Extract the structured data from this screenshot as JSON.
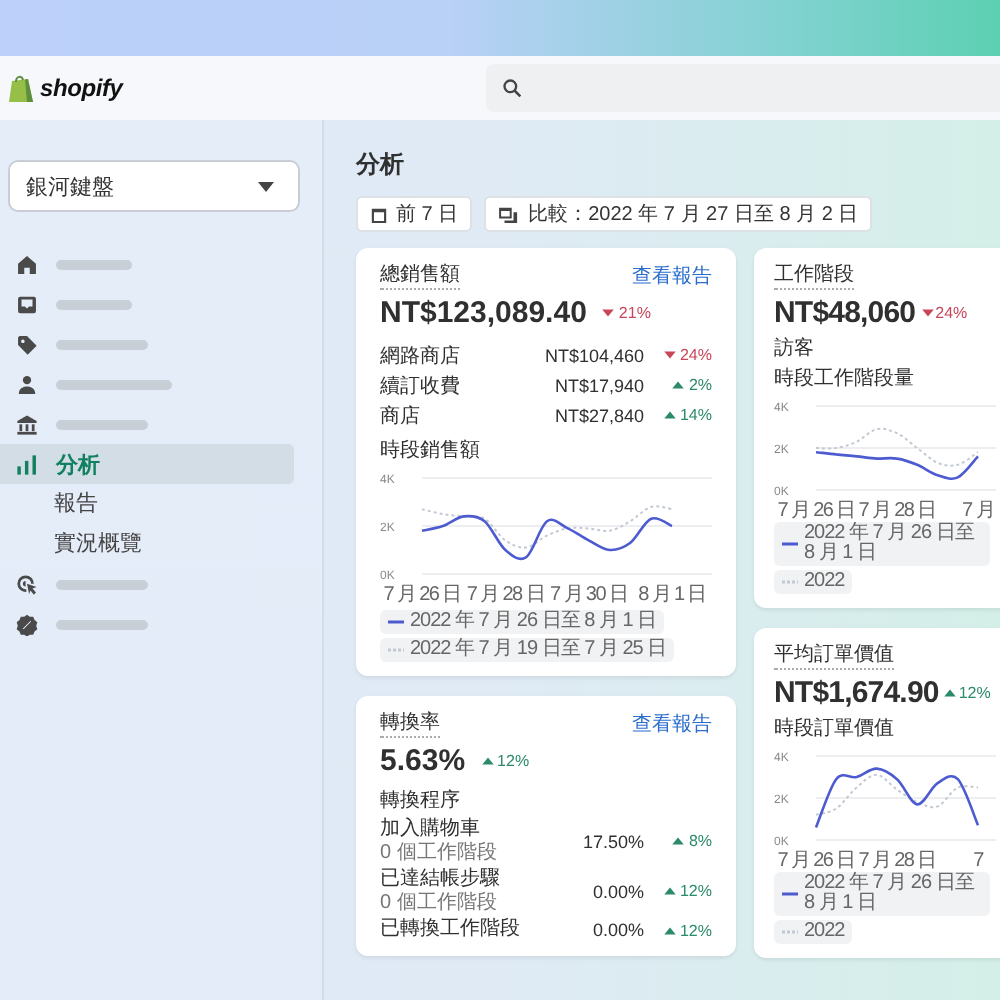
{
  "header": {
    "logo": "shopify"
  },
  "store_selector": {
    "label": "銀河鍵盤"
  },
  "nav": {
    "items": [
      {
        "kind": "redacted",
        "selected": false
      },
      {
        "kind": "redacted",
        "selected": false
      },
      {
        "kind": "redacted",
        "selected": false
      },
      {
        "kind": "redacted",
        "selected": false
      },
      {
        "kind": "redacted",
        "selected": false
      },
      {
        "kind": "label",
        "label": "分析",
        "selected": true,
        "children": [
          {
            "label": "報告"
          },
          {
            "label": "實況概覽"
          }
        ]
      },
      {
        "kind": "redacted",
        "selected": false
      },
      {
        "kind": "redacted",
        "selected": false
      }
    ]
  },
  "page": {
    "title": "分析",
    "filters": [
      {
        "kind": "date",
        "label": "前 7 日"
      },
      {
        "kind": "compare",
        "label": "比較：2022 年 7 月 27 日至 8 月 2 日"
      }
    ]
  },
  "columns": [
    {
      "cards": [
        {
          "title": "總銷售額",
          "link": "查看報告",
          "value": "NT$123,089.40",
          "trend": {
            "up": false,
            "text": "21%"
          },
          "breakdown": [
            {
              "label": "網路商店",
              "value": "NT$104,460",
              "trend": {
                "up": false,
                "text": "24%"
              }
            },
            {
              "label": "續訂收費",
              "value": "NT$17,940",
              "trend": {
                "up": true,
                "text": "2%"
              }
            },
            {
              "label": "商店",
              "value": "NT$27,840",
              "trend": {
                "up": true,
                "text": "14%"
              }
            }
          ],
          "chart_title": "時段銷售額",
          "chart_data": {
            "type": "line",
            "categories": [
              "7 月 26 日",
              null,
              null,
              null,
              "7 月 28 日",
              null,
              null,
              null,
              "7 月 30 日",
              null,
              null,
              null,
              "8 月 1 日"
            ],
            "ylim": [
              0,
              4000
            ],
            "yticks": [
              {
                "value": 0,
                "label": "0K"
              },
              {
                "value": 2000,
                "label": "2K"
              },
              {
                "value": 4000,
                "label": "4K"
              }
            ],
            "series": [
              {
                "name": "2022 年 7 月 26 日至 8 月 1 日",
                "color": "#4d5bd1",
                "line_style": "solid",
                "values": [
                  1800,
                  2000,
                  2400,
                  2200,
                  1000,
                  700,
                  2200,
                  1900,
                  1400,
                  1000,
                  1300,
                  2300,
                  2000
                ]
              },
              {
                "name": "2022 年 7 月 19 日至 7 月 25 日",
                "color": "#c3c9d3",
                "line_style": "dotted",
                "values": [
                  2700,
                  2500,
                  2400,
                  2300,
                  1400,
                  1100,
                  1600,
                  1900,
                  1900,
                  1800,
                  2200,
                  2800,
                  2700
                ]
              }
            ]
          }
        },
        {
          "title": "轉換率",
          "link": "查看報告",
          "value": "5.63%",
          "trend": {
            "up": true,
            "text": "12%"
          },
          "steps_title": "轉換程序",
          "steps": [
            {
              "label": "加入購物車",
              "sessions": "0 個工作階段",
              "rate": "17.50%",
              "trend": {
                "up": true,
                "text": "8%"
              }
            },
            {
              "label": "已達結帳步驟",
              "sessions": "0 個工作階段",
              "rate": "0.00%",
              "trend": {
                "up": true,
                "text": "12%"
              }
            },
            {
              "label": "已轉換工作階段",
              "rate": "0.00%",
              "trend": {
                "up": true,
                "text": "12%"
              }
            }
          ]
        }
      ]
    },
    {
      "cards": [
        {
          "title": "工作階段",
          "value": "NT$48,060",
          "trend": {
            "up": false,
            "text": "24%"
          },
          "subtitle": "訪客",
          "chart_title": "時段工作階段量",
          "chart_data": {
            "type": "line",
            "categories": [
              "7 月 26 日",
              null,
              null,
              null,
              "7 月 28 日",
              null,
              null,
              null,
              "7 月"
            ],
            "ylim": [
              0,
              4000
            ],
            "yticks": [
              {
                "value": 0,
                "label": "0K"
              },
              {
                "value": 2000,
                "label": "2K"
              },
              {
                "value": 4000,
                "label": "4K"
              }
            ],
            "series": [
              {
                "name": "2022 年 7 月 26 日至 8 月 1 日",
                "color": "#4d5bd1",
                "line_style": "solid",
                "values": [
                  1800,
                  1700,
                  1600,
                  1500,
                  1500,
                  1200,
                  700,
                  600,
                  1600
                ]
              },
              {
                "name": "2022",
                "color": "#c3c9d3",
                "line_style": "dotted",
                "values": [
                  2000,
                  2000,
                  2300,
                  2900,
                  2700,
                  2000,
                  1300,
                  1200,
                  1800
                ]
              }
            ]
          }
        },
        {
          "title": "平均訂單價值",
          "value": "NT$1,674.90",
          "trend": {
            "up": true,
            "text": "12%"
          },
          "chart_title": "時段訂單價值",
          "chart_data": {
            "type": "line",
            "categories": [
              "7 月 26 日",
              null,
              null,
              null,
              "7 月 28 日",
              null,
              null,
              null,
              "7"
            ],
            "ylim": [
              0,
              4000
            ],
            "yticks": [
              {
                "value": 0,
                "label": "0K"
              },
              {
                "value": 2000,
                "label": "2K"
              },
              {
                "value": 4000,
                "label": "4K"
              }
            ],
            "series": [
              {
                "name": "2022 年 7 月 26 日至 8 月 1 日",
                "color": "#4d5bd1",
                "line_style": "solid",
                "values": [
                  600,
                  2900,
                  3000,
                  3400,
                  2900,
                  1700,
                  2700,
                  2900,
                  700
                ]
              },
              {
                "name": "2022",
                "color": "#c3c9d3",
                "line_style": "dotted",
                "values": [
                  1200,
                  1500,
                  2500,
                  3100,
                  2400,
                  1800,
                  1600,
                  2500,
                  2500
                ]
              }
            ]
          }
        }
      ]
    }
  ]
}
